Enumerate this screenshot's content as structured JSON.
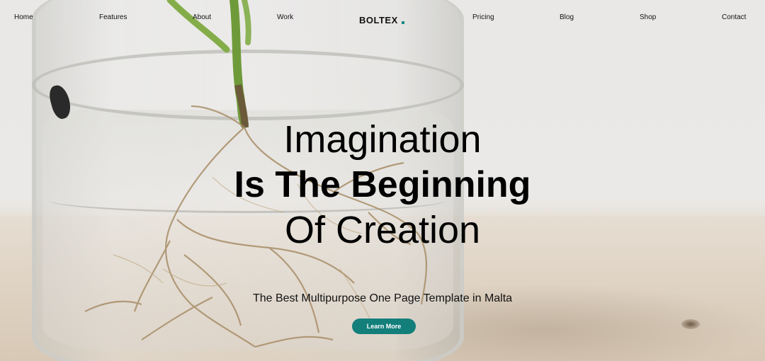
{
  "nav": {
    "items": [
      {
        "label": "Home"
      },
      {
        "label": "Features"
      },
      {
        "label": "About"
      },
      {
        "label": "Work"
      },
      {
        "label": "Pricing"
      },
      {
        "label": "Blog"
      },
      {
        "label": "Shop"
      },
      {
        "label": "Contact"
      }
    ],
    "brand": "BOLTEX"
  },
  "hero": {
    "line1": "Imagination",
    "line2": "Is The Beginning",
    "line3": "Of Creation",
    "subtitle": "The Best Multipurpose One Page Template in Malta",
    "cta_label": "Learn More"
  },
  "colors": {
    "accent": "#137f7b",
    "brand_dot": "#1c8a86",
    "text": "#000000"
  }
}
